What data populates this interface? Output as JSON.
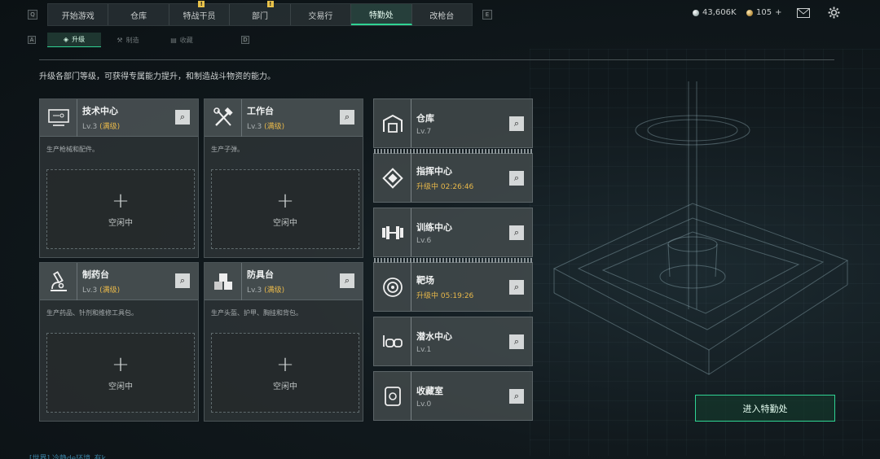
{
  "topnav": {
    "left_key": "Q",
    "right_key": "E",
    "tabs": [
      {
        "label": "开始游戏",
        "alert": ""
      },
      {
        "label": "仓库",
        "alert": ""
      },
      {
        "label": "特战干员",
        "alert": "!"
      },
      {
        "label": "部门",
        "alert": "!"
      },
      {
        "label": "交易行",
        "alert": ""
      },
      {
        "label": "特勤处",
        "alert": "",
        "active": true
      },
      {
        "label": "改枪台",
        "alert": ""
      }
    ]
  },
  "currency": {
    "silver": "43,606K",
    "gold": "105",
    "gold_add": "+"
  },
  "subnav": {
    "left_key": "A",
    "right_key": "D",
    "tabs": [
      {
        "label": "升级",
        "active": true
      },
      {
        "label": "制造"
      },
      {
        "label": "收藏"
      }
    ]
  },
  "description": "升级各部门等级，可获得专属能力提升，和制造战斗物资的能力。",
  "big_cards": [
    {
      "name": "技术中心",
      "level": "Lv.3",
      "max": "(满级)",
      "sub": "生产枪械和配件。",
      "icon": "computer-icon",
      "slot_plus": "+",
      "slot_status": "空闲中"
    },
    {
      "name": "工作台",
      "level": "Lv.3",
      "max": "(满级)",
      "sub": "生产子弹。",
      "icon": "tools-icon",
      "slot_plus": "+",
      "slot_status": "空闲中"
    },
    {
      "name": "制药台",
      "level": "Lv.3",
      "max": "(满级)",
      "sub": "生产药品、针剂和维修工具包。",
      "icon": "microscope-icon",
      "slot_plus": "+",
      "slot_status": "空闲中"
    },
    {
      "name": "防具台",
      "level": "Lv.3",
      "max": "(满级)",
      "sub": "生产头盔、护甲、胸挂和背包。",
      "icon": "armor-icon",
      "slot_plus": "+",
      "slot_status": "空闲中"
    }
  ],
  "small_cards": [
    {
      "name": "仓库",
      "level": "Lv.7",
      "upgrading": false,
      "icon": "warehouse-icon"
    },
    {
      "name": "指挥中心",
      "level": "升级中 02:26:46",
      "upgrading": true,
      "icon": "command-icon"
    },
    {
      "name": "训练中心",
      "level": "Lv.6",
      "upgrading": false,
      "icon": "dumbbell-icon"
    },
    {
      "name": "靶场",
      "level": "升级中 05:19:26",
      "upgrading": true,
      "icon": "target-icon"
    },
    {
      "name": "潜水中心",
      "level": "Lv.1",
      "upgrading": false,
      "icon": "diving-mask-icon"
    },
    {
      "name": "收藏室",
      "level": "Lv.0",
      "upgrading": false,
      "icon": "collection-icon"
    }
  ],
  "enter_button": "进入特勤处",
  "chat_line": "[世界] 冷静de环境_有k"
}
